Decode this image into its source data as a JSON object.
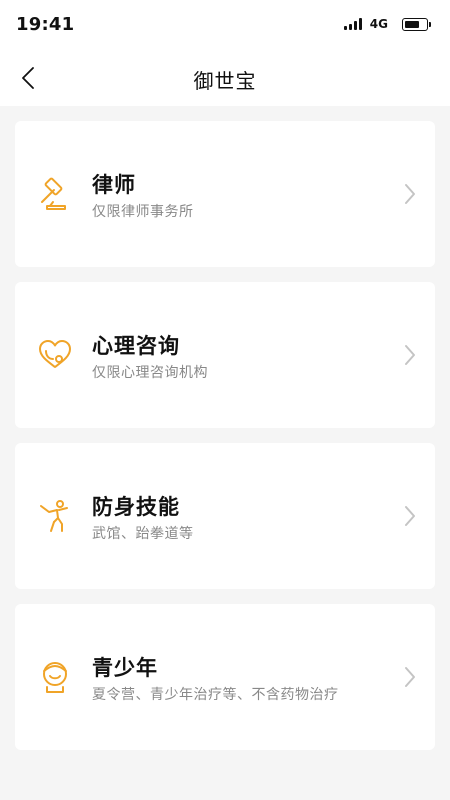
{
  "status_bar": {
    "time": "19:41",
    "network": "4G",
    "battery_level": 0.75
  },
  "nav": {
    "title": "御世宝"
  },
  "colors": {
    "accent": "#f0a428",
    "chevron": "#c4c4c4"
  },
  "services": [
    {
      "title": "律师",
      "subtitle": "仅限律师事务所",
      "icon": "gavel-icon"
    },
    {
      "title": "心理咨询",
      "subtitle": "仅限心理咨询机构",
      "icon": "heart-stethoscope-icon"
    },
    {
      "title": "防身技能",
      "subtitle": "武馆、跆拳道等",
      "icon": "martial-arts-kick-icon"
    },
    {
      "title": "青少年",
      "subtitle": "夏令营、青少年治疗等、不含药物治疗",
      "icon": "youth-face-icon"
    }
  ]
}
